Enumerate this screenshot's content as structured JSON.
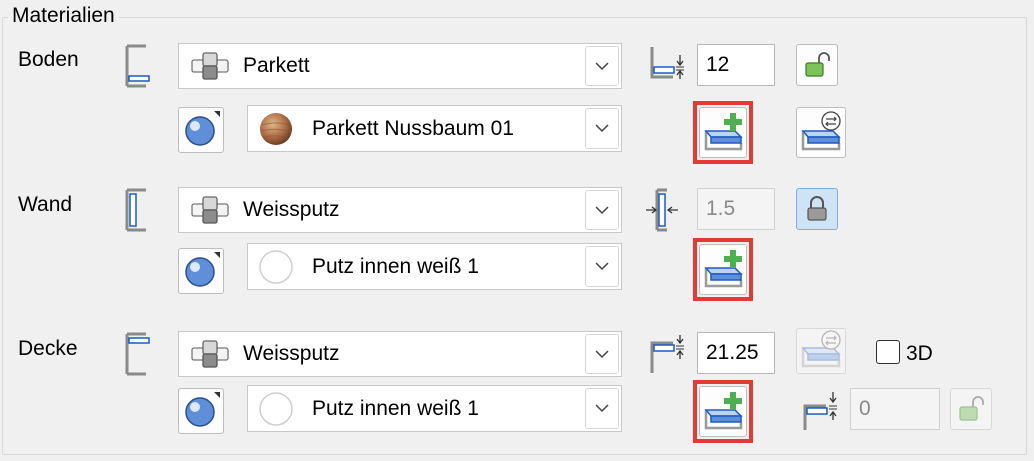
{
  "group_title": "Materialien",
  "rows": [
    {
      "label": "Boden",
      "material": "Parkett",
      "texture": "Parkett Nussbaum 01",
      "thickness": "12",
      "lock_state": "unlocked"
    },
    {
      "label": "Wand",
      "material": "Weissputz",
      "texture": "Putz innen weiß 1",
      "thickness": "1.5",
      "lock_state": "locked"
    },
    {
      "label": "Decke",
      "material": "Weissputz",
      "texture": "Putz innen weiß 1",
      "thickness": "21.25",
      "offset": "0",
      "checkbox_3d_label": "3D",
      "checkbox_3d_checked": false
    }
  ],
  "colors": {
    "highlight": "#e53935",
    "accent_blue": "#1e5bc6",
    "plus_green": "#4caf50",
    "lock_green": "#6fbf4d"
  },
  "icons": {
    "material_selector": "material-blocks-icon",
    "texture_selector": "sphere-icon",
    "dropdown": "chevron-down-icon",
    "add_material": "add-material-icon",
    "edit_material": "edit-material-icon",
    "lock": "lock-icon"
  }
}
